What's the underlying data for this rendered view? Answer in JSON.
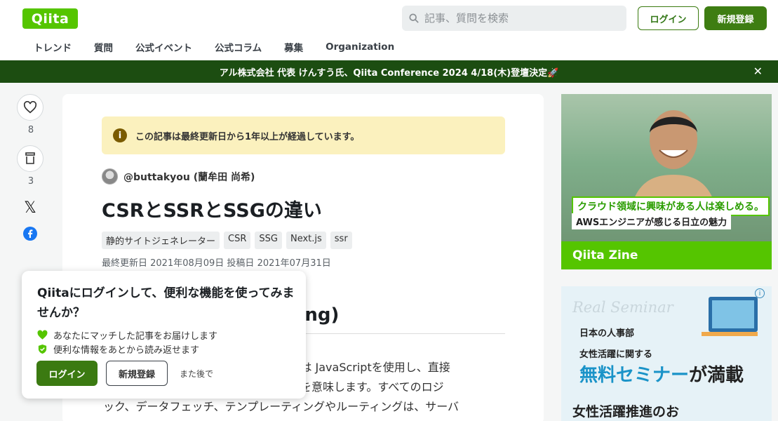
{
  "header": {
    "logo": "Qiita",
    "search_placeholder": "記事、質問を検索",
    "login_label": "ログイン",
    "signup_label": "新規登録",
    "nav": [
      "トレンド",
      "質問",
      "公式イベント",
      "公式コラム",
      "募集",
      "Organization"
    ]
  },
  "banner": {
    "text": "アル株式会社 代表 けんすう氏、Qiita Conference 2024 4/18(木)登壇決定🚀",
    "close": "✕"
  },
  "side": {
    "likes": "8",
    "stocks": "3",
    "x_label": "𝕏"
  },
  "article": {
    "notice": "この記事は最終更新日から1年以上が経過しています。",
    "author": "@buttakyou (蘭牟田 尚希)",
    "title": "CSRとSSRとSSGの違い",
    "tags": [
      "静的サイトジェネレーター",
      "CSR",
      "SSG",
      "Next.js",
      "ssr"
    ],
    "dates": "最終更新日 2021年08月09日 投稿日 2021年07月31日",
    "heading_partial": "ering)",
    "body_line1": "CSR）は JavaScriptを使用し、直接",
    "body_line2": "ることを意味します。すべてのロジ",
    "body_line3": "ック、データフェッチ、テンプレーティングやルーティングは、サーバ"
  },
  "popup": {
    "title": "Qiitaにログインして、便利な機能を使ってみませんか？",
    "benefit1": "あなたにマッチした記事をお届けします",
    "benefit2": "便利な情報をあとから読み返せます",
    "login_label": "ログイン",
    "signup_label": "新規登録",
    "later_label": "また後で"
  },
  "ad1": {
    "headline": "クラウド領域に興味がある人は楽しめる。",
    "sub": "AWSエンジニアが感じる日立の魅力",
    "footer": "Qiita Zine"
  },
  "ad2": {
    "bg_text": "Real Seminar",
    "company": "日本の人事部",
    "line1": "女性活躍に関する",
    "line2a": "無料セミナー",
    "line2b": "が満載",
    "line3": "女性活躍推進のお",
    "info": "i"
  },
  "colors": {
    "brand": "#55c500",
    "banner": "#1c4d11",
    "button": "#3e7d12"
  }
}
